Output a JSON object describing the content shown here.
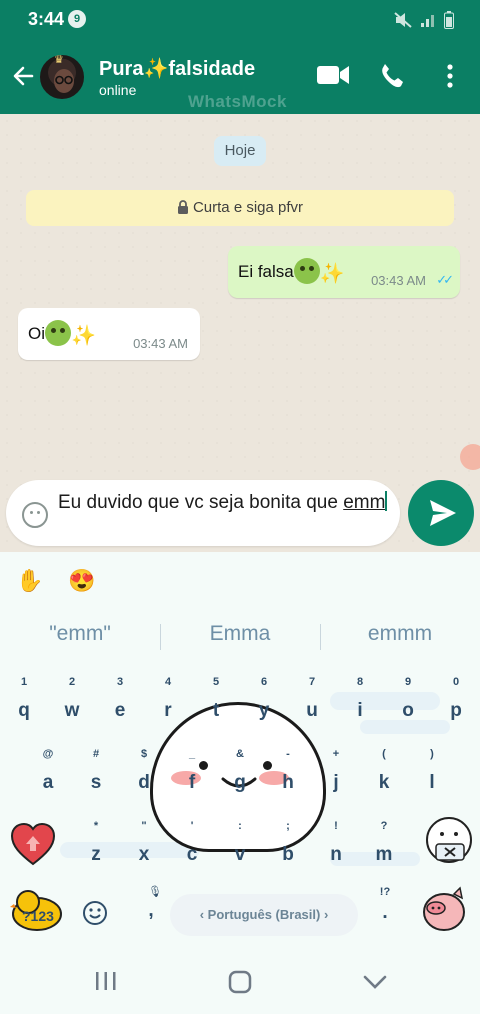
{
  "status_bar": {
    "time": "3:44",
    "notification_count": "9"
  },
  "header": {
    "contact_name": "Pura✨falsidade",
    "contact_status": "online",
    "watermark": "WhatsMock",
    "icons": [
      "back-arrow-icon",
      "video-call-icon",
      "phone-icon",
      "more-options-icon"
    ]
  },
  "chat": {
    "date_chip": "Hoje",
    "info_banner": "Curta e siga pfvr",
    "messages": [
      {
        "direction": "outgoing",
        "text": "Ei falsa",
        "emoji": "nauseated-face ✨",
        "time": "03:43 AM",
        "status": "read"
      },
      {
        "direction": "incoming",
        "text": "Oi",
        "emoji": "nauseated-face ✨",
        "time": "03:43 AM"
      }
    ]
  },
  "composer": {
    "text_before": "Eu duvido que vc seja bonita que ",
    "typed_word": "emm"
  },
  "keyboard": {
    "toolbar": [
      "raised-hand-emoji",
      "heart-eyes-emoji"
    ],
    "suggestions": [
      "\"emm\"",
      "Emma",
      "emmm"
    ],
    "row1_hints": [
      "1",
      "2",
      "3",
      "4",
      "5",
      "6",
      "7",
      "8",
      "9",
      "0"
    ],
    "row1": [
      "q",
      "w",
      "e",
      "r",
      "t",
      "y",
      "u",
      "i",
      "o",
      "p"
    ],
    "row2_hints": [
      "@",
      "#",
      "$",
      "_",
      "&",
      "-",
      "+",
      "(",
      ")"
    ],
    "row2": [
      "a",
      "s",
      "d",
      "f",
      "g",
      "h",
      "j",
      "k",
      "l"
    ],
    "row3_hints": [
      "*",
      "\"",
      "'",
      ":",
      ";",
      "!",
      "?"
    ],
    "row3": [
      "z",
      "x",
      "c",
      "v",
      "b",
      "n",
      "m"
    ],
    "symbols_key": "?123",
    "comma": ",",
    "period": ".",
    "period_hint": "!?",
    "language": "Português (Brasil)"
  },
  "colors": {
    "header": "#0b7f64",
    "outgoing_bubble": "#dcf7c5",
    "incoming_bubble": "#ffffff",
    "banner": "#fbf3bf",
    "date_chip": "#d8ecf4",
    "send_button": "#0b8a6c",
    "key_text": "#2f4e6a"
  }
}
